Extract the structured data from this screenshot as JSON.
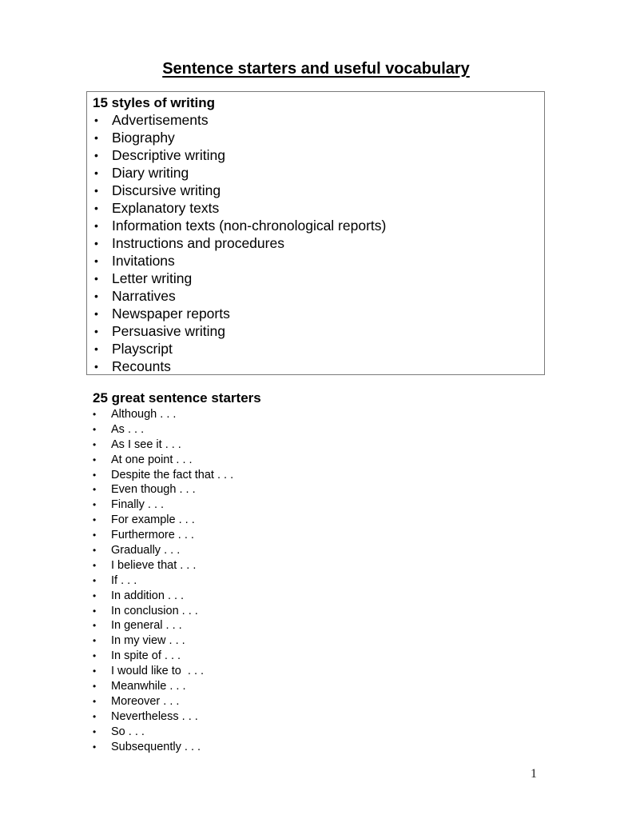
{
  "document": {
    "title": "Sentence starters and useful vocabulary",
    "page_number": "1"
  },
  "styles_section": {
    "heading": "15 styles of writing",
    "bullet": "•",
    "items": [
      "Advertisements",
      "Biography",
      "Descriptive writing",
      "Diary writing",
      "Discursive writing",
      "Explanatory texts",
      "Information texts (non-chronological reports)",
      "Instructions and procedures",
      "Invitations",
      "Letter writing",
      "Narratives",
      "Newspaper reports",
      "Persuasive writing",
      "Playscript",
      "Recounts"
    ]
  },
  "starters_section": {
    "heading": "25 great sentence starters",
    "bullet": "•",
    "items": [
      "Although . . .",
      "As . . .",
      "As I see it . . .",
      "At one point . . .",
      "Despite the fact that . . .",
      "Even though . . .",
      "Finally . . .",
      "For example . . .",
      "Furthermore . . .",
      "Gradually . . .",
      "I believe that . . .",
      "If . . .",
      "In addition . . .",
      "In conclusion . . .",
      "In general . . .",
      "In my view . . .",
      "In spite of . . .",
      "I would like to  . . .",
      "Meanwhile . . .",
      "Moreover . . .",
      "Nevertheless . . .",
      "So . . .",
      "Subsequently . . ."
    ]
  }
}
